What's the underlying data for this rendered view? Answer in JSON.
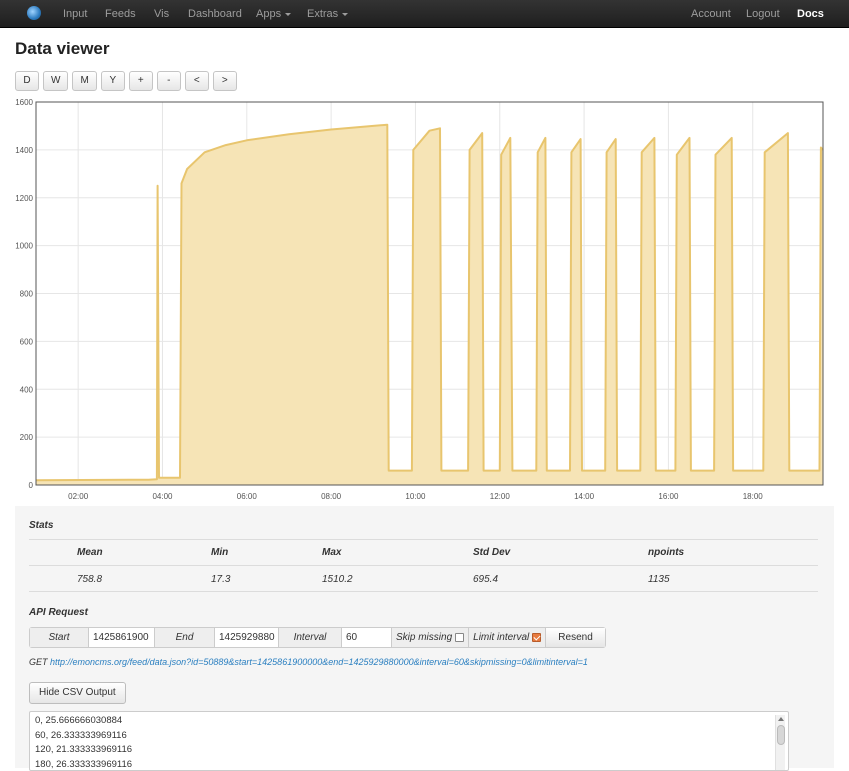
{
  "navbar": {
    "logo_icon": "emoncms-globe-icon",
    "items": [
      "Input",
      "Feeds",
      "Vis",
      "Dashboard"
    ],
    "apps_label": "Apps",
    "extras_label": "Extras",
    "account_label": "Account",
    "logout_label": "Logout",
    "docs_label": "Docs"
  },
  "page": {
    "title": "Data viewer"
  },
  "range_buttons": [
    "D",
    "W",
    "M",
    "Y",
    "+",
    "-",
    "<",
    ">"
  ],
  "chart_data": {
    "type": "area",
    "color": "#e8c56e",
    "fill_color": "#f6e4b6",
    "x_range": [
      "01:00",
      "19:40"
    ],
    "x_ticks": [
      "02:00",
      "04:00",
      "06:00",
      "08:00",
      "10:00",
      "12:00",
      "14:00",
      "16:00",
      "18:00"
    ],
    "ylim": [
      0,
      1600
    ],
    "y_ticks": [
      0,
      200,
      400,
      600,
      800,
      1000,
      1200,
      1400,
      1600
    ],
    "grid": true,
    "points": [
      [
        "01:00",
        20
      ],
      [
        "03:40",
        22
      ],
      [
        "03:52",
        24
      ],
      [
        "03:53",
        1250
      ],
      [
        "03:55",
        30
      ],
      [
        "04:25",
        30
      ],
      [
        "04:27",
        1260
      ],
      [
        "04:35",
        1320
      ],
      [
        "05:00",
        1390
      ],
      [
        "05:30",
        1420
      ],
      [
        "06:00",
        1440
      ],
      [
        "07:00",
        1465
      ],
      [
        "08:00",
        1485
      ],
      [
        "09:00",
        1500
      ],
      [
        "09:20",
        1505
      ],
      [
        "09:22",
        60
      ],
      [
        "09:55",
        60
      ],
      [
        "09:57",
        1400
      ],
      [
        "10:20",
        1480
      ],
      [
        "10:35",
        1490
      ],
      [
        "10:37",
        60
      ],
      [
        "11:15",
        60
      ],
      [
        "11:17",
        1400
      ],
      [
        "11:35",
        1470
      ],
      [
        "11:37",
        60
      ],
      [
        "12:00",
        60
      ],
      [
        "12:02",
        1380
      ],
      [
        "12:15",
        1450
      ],
      [
        "12:18",
        60
      ],
      [
        "12:52",
        60
      ],
      [
        "12:54",
        1390
      ],
      [
        "13:05",
        1450
      ],
      [
        "13:07",
        60
      ],
      [
        "13:40",
        60
      ],
      [
        "13:42",
        1390
      ],
      [
        "13:55",
        1445
      ],
      [
        "13:57",
        60
      ],
      [
        "14:30",
        60
      ],
      [
        "14:32",
        1390
      ],
      [
        "14:45",
        1445
      ],
      [
        "14:47",
        60
      ],
      [
        "15:20",
        60
      ],
      [
        "15:22",
        1390
      ],
      [
        "15:40",
        1450
      ],
      [
        "15:42",
        60
      ],
      [
        "16:10",
        60
      ],
      [
        "16:12",
        1380
      ],
      [
        "16:30",
        1450
      ],
      [
        "16:32",
        60
      ],
      [
        "17:05",
        60
      ],
      [
        "17:07",
        1380
      ],
      [
        "17:30",
        1450
      ],
      [
        "17:32",
        60
      ],
      [
        "18:15",
        60
      ],
      [
        "18:17",
        1390
      ],
      [
        "18:50",
        1470
      ],
      [
        "18:52",
        60
      ],
      [
        "19:35",
        60
      ],
      [
        "19:37",
        1410
      ],
      [
        "19:40",
        1400
      ]
    ]
  },
  "stats": {
    "title": "Stats",
    "headers": [
      "Mean",
      "Min",
      "Max",
      "Std Dev",
      "npoints"
    ],
    "values": [
      "758.8",
      "17.3",
      "1510.2",
      "695.4",
      "1135"
    ]
  },
  "api": {
    "title": "API Request",
    "start_label": "Start",
    "start_value": "1425861900",
    "end_label": "End",
    "end_value": "1425929880",
    "interval_label": "Interval",
    "interval_value": "60",
    "skip_missing_label": "Skip missing",
    "skip_missing_checked": false,
    "limit_interval_label": "Limit interval",
    "limit_interval_checked": true,
    "resend_label": "Resend",
    "get_prefix": "GET",
    "get_url": "http://emoncms.org/feed/data.json?id=50889&start=1425861900000&end=1425929880000&interval=60&skipmissing=0&limitinterval=1"
  },
  "csv": {
    "toggle_label": "Hide CSV Output",
    "lines": [
      "0, 25.666666030884",
      "60, 26.333333969116",
      "120, 21.333333969116",
      "180, 26.333333969116"
    ]
  }
}
